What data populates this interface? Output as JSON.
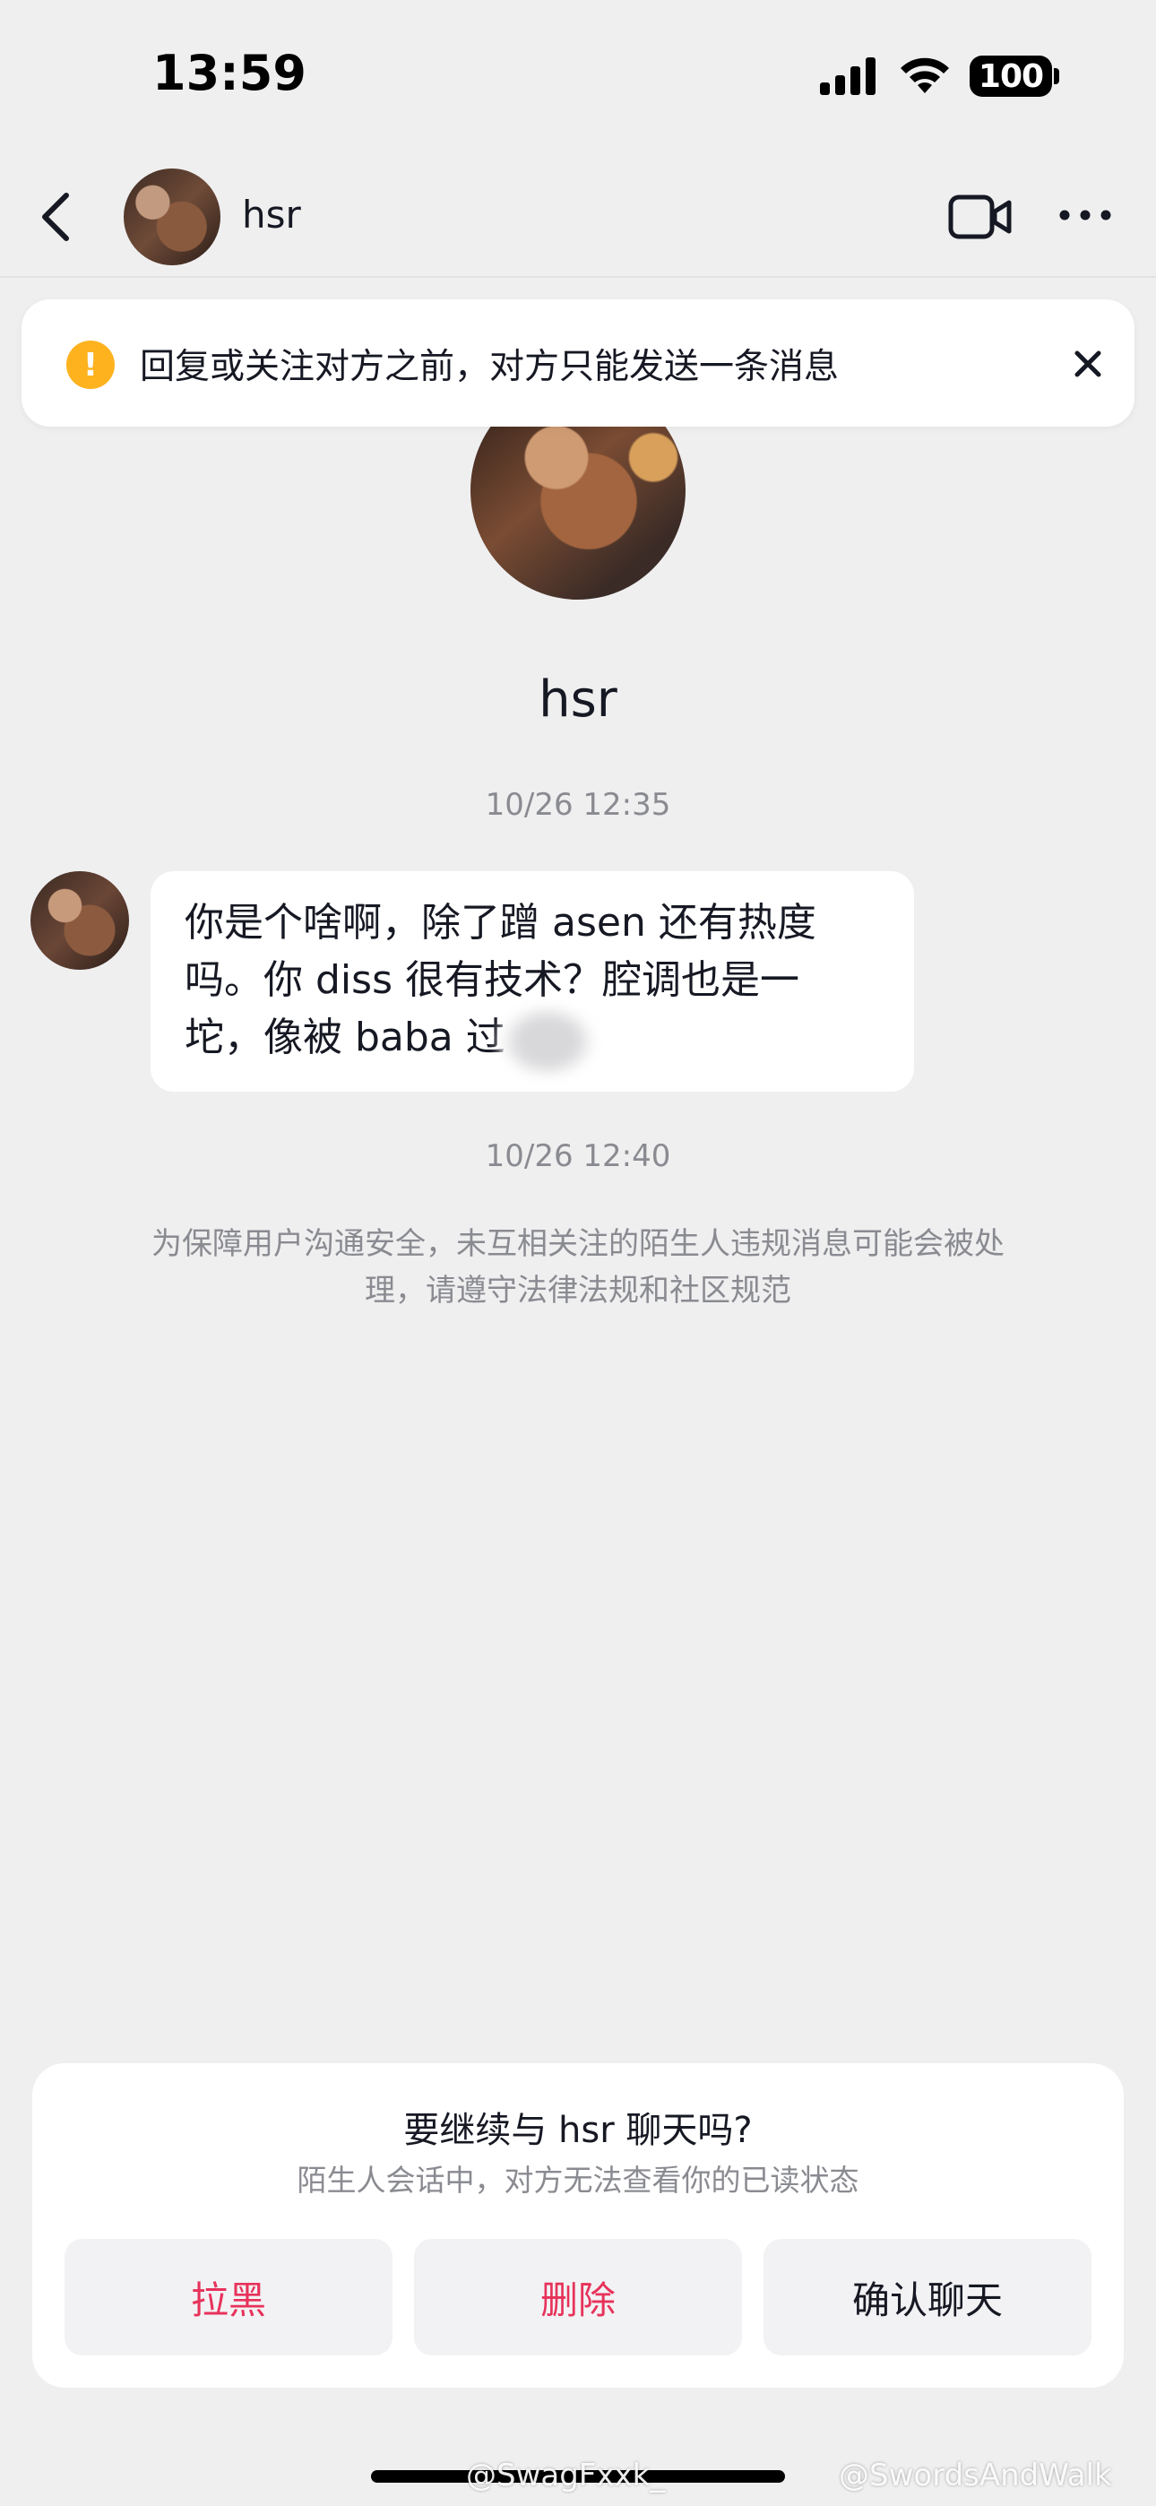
{
  "status_bar": {
    "time": "13:59",
    "battery": "100"
  },
  "header": {
    "contact_name": "hsr"
  },
  "notice": {
    "text": "回复或关注对方之前，对方只能发送一条消息",
    "icon": "!"
  },
  "profile": {
    "name": "hsr"
  },
  "chat": {
    "timestamp_1": "10/26 12:35",
    "message_lines": [
      "你是个啥啊，除了蹭 asen 还有热度",
      "吗。你 diss 很有技术？腔调也是一",
      "坨，像被 baba        过"
    ],
    "timestamp_2": "10/26 12:40",
    "safety_note": "为保障用户沟通安全，未互相关注的陌生人违规消息可能会被处理，请遵守法律法规和社区规范"
  },
  "prompt_card": {
    "title": "要继续与 hsr 聊天吗?",
    "subtitle": "陌生人会话中，对方无法查看你的已读状态",
    "buttons": {
      "block": "拉黑",
      "delete": "删除",
      "confirm": "确认聊天"
    }
  },
  "watermarks": {
    "left": "@SwagFxxk_",
    "right": "@SwordsAndWalk"
  },
  "colors": {
    "background": "#efeff0",
    "danger": "#e7325a",
    "warning": "#fdb21e",
    "muted_text": "#8a8b91"
  },
  "icons": [
    "back-arrow-icon",
    "video-call-icon",
    "more-icon",
    "warning-icon",
    "close-icon",
    "signal-icon",
    "wifi-icon",
    "battery-icon"
  ]
}
